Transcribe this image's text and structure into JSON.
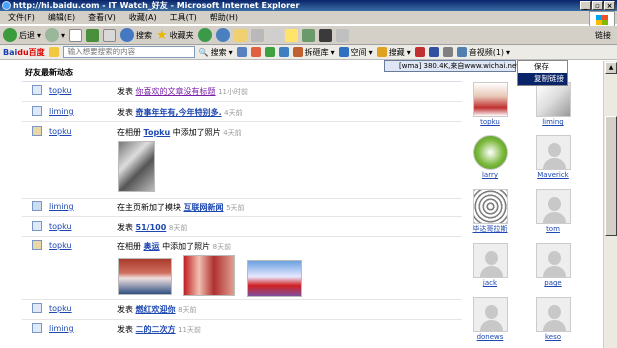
{
  "window": {
    "title": "http://hi.baidu.com - IT Watch_好友 - Microsoft Internet Explorer"
  },
  "menubar": {
    "items": [
      "文件(F)",
      "编辑(E)",
      "查看(V)",
      "收藏(A)",
      "工具(T)",
      "帮助(H)"
    ]
  },
  "toolbar": {
    "back": "后退",
    "search": "搜索",
    "favorites": "收藏夹",
    "links": "链接"
  },
  "baidubar": {
    "logo_a": "Bai",
    "logo_b": "du百度",
    "search_placeholder": "输入想要搜索的内容",
    "search_button": "搜索",
    "toolbox": "拆砸库",
    "space": "空间",
    "souxiang": "搜藏",
    "music": "音视频(1)"
  },
  "media_popup": {
    "text": "[wma] 380.4K,来自www.wichai.net"
  },
  "context_menu": {
    "items": [
      "保存",
      "复制链接"
    ]
  },
  "feed": {
    "heading": "好友最新动态",
    "items": [
      {
        "user": "topku",
        "action": "发表",
        "link": "你喜欢的文章没有标题",
        "time": "11小时前"
      },
      {
        "user": "liming",
        "action": "发表",
        "link": "奇事年年有,今年特别多.",
        "time": "4天前"
      },
      {
        "user": "topku",
        "action": "在相册",
        "link": "Topku",
        "suffix": "中添加了照片",
        "time": "4天前"
      },
      {
        "user": "liming",
        "action": "在主页新加了模块",
        "link": "互联网新闻",
        "time": "5天前"
      },
      {
        "user": "topku",
        "action": "发表",
        "link": "51/100",
        "time": "8天前"
      },
      {
        "user": "topku",
        "action": "在相册",
        "link": "奥运",
        "suffix": "中添加了照片",
        "time": "8天前"
      },
      {
        "user": "topku",
        "action": "发表",
        "link": "燃红欢迎你",
        "time": "8天前"
      },
      {
        "user": "liming",
        "action": "发表",
        "link": "二的二次方",
        "time": "11天前"
      }
    ]
  },
  "friends": [
    "topku",
    "liming",
    "larry",
    "Maverick",
    "毕达哥拉斯",
    "tom",
    "jack",
    "page",
    "donews",
    "keso"
  ]
}
